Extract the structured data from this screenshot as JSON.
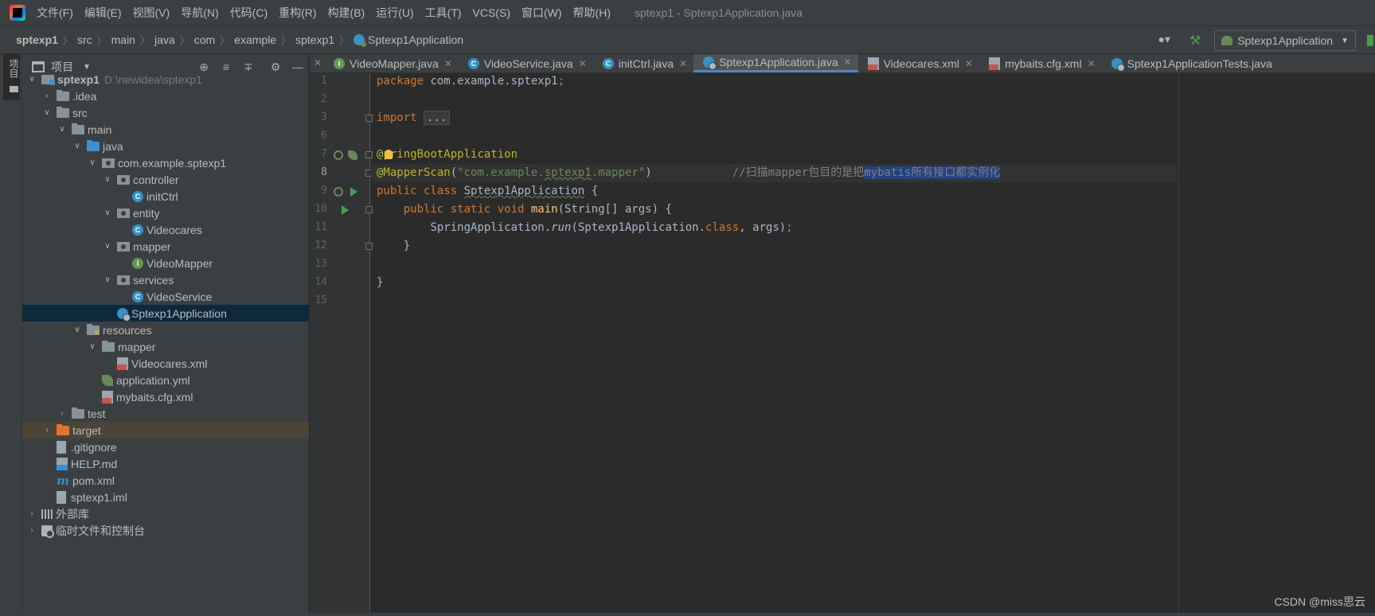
{
  "menubar": {
    "items": [
      "文件(F)",
      "编辑(E)",
      "视图(V)",
      "导航(N)",
      "代码(C)",
      "重构(R)",
      "构建(B)",
      "运行(U)",
      "工具(T)",
      "VCS(S)",
      "窗口(W)",
      "帮助(H)"
    ],
    "window_title": "sptexp1 - Sptexp1Application.java"
  },
  "navbar": {
    "breadcrumb": [
      "sptexp1",
      "src",
      "main",
      "java",
      "com",
      "example",
      "sptexp1",
      "Sptexp1Application"
    ],
    "run_config": "Sptexp1Application"
  },
  "left_stripe": {
    "project_label": "项目"
  },
  "project_panel": {
    "title": "项目",
    "tree": [
      {
        "label": "sptexp1",
        "path": "D:\\newidea\\sptexp1",
        "icon": "module-folder"
      },
      {
        "label": ".idea",
        "icon": "folder"
      },
      {
        "label": "src",
        "icon": "folder"
      },
      {
        "label": "main",
        "icon": "folder"
      },
      {
        "label": "java",
        "icon": "source-folder"
      },
      {
        "label": "com.example.sptexp1",
        "icon": "package"
      },
      {
        "label": "controller",
        "icon": "package"
      },
      {
        "label": "initCtrl",
        "icon": "class"
      },
      {
        "label": "entity",
        "icon": "package"
      },
      {
        "label": "Videocares",
        "icon": "class"
      },
      {
        "label": "mapper",
        "icon": "package"
      },
      {
        "label": "VideoMapper",
        "icon": "interface"
      },
      {
        "label": "services",
        "icon": "package"
      },
      {
        "label": "VideoService",
        "icon": "class"
      },
      {
        "label": "Sptexp1Application",
        "icon": "spring-boot-class"
      },
      {
        "label": "resources",
        "icon": "resources-folder"
      },
      {
        "label": "mapper",
        "icon": "folder"
      },
      {
        "label": "Videocares.xml",
        "icon": "xml-file"
      },
      {
        "label": "application.yml",
        "icon": "yaml-file"
      },
      {
        "label": "mybaits.cfg.xml",
        "icon": "xml-file"
      },
      {
        "label": "test",
        "icon": "folder"
      },
      {
        "label": "target",
        "icon": "excluded-folder"
      },
      {
        "label": ".gitignore",
        "icon": "file"
      },
      {
        "label": "HELP.md",
        "icon": "markdown-file"
      },
      {
        "label": "pom.xml",
        "icon": "maven-file"
      },
      {
        "label": "sptexp1.iml",
        "icon": "file"
      },
      {
        "label": "外部库",
        "icon": "library"
      },
      {
        "label": "临时文件和控制台",
        "icon": "scratch"
      }
    ]
  },
  "editor": {
    "tabs": [
      {
        "label": "VideoMapper.java",
        "icon": "interface",
        "active": false
      },
      {
        "label": "VideoService.java",
        "icon": "class",
        "active": false
      },
      {
        "label": "initCtrl.java",
        "icon": "class",
        "active": false
      },
      {
        "label": "Sptexp1Application.java",
        "icon": "spring-boot-class",
        "active": true
      },
      {
        "label": "Videocares.xml",
        "icon": "xml-file",
        "active": false
      },
      {
        "label": "mybaits.cfg.xml",
        "icon": "xml-file",
        "active": false
      },
      {
        "label": "Sptexp1ApplicationTests.java",
        "icon": "spring-boot-class",
        "active": false
      }
    ],
    "line_numbers": [
      "1",
      "2",
      "3",
      "6",
      "7",
      "8",
      "9",
      "10",
      "11",
      "12",
      "13",
      "14",
      "15"
    ],
    "current_line": "8",
    "code": {
      "l1_kw": "package",
      "l1_rest": " com.example.sptexp1",
      "l1_semi": ";",
      "l3_kw": "import",
      "l3_fold": "...",
      "l7_at": "@",
      "l7_ann": "pringBootApplication",
      "l8_ann": "@MapperScan",
      "l8_p1": "(",
      "l8_s1": "\"com.example.",
      "l8_s2": "sptexp1",
      "l8_s3": ".mapper\"",
      "l8_p2": ")",
      "l8_cmt": "//扫描mapper包目的是把",
      "l8_cmt_sel": "mybatis所有接口都实例化",
      "l9_kw": "public class ",
      "l9_cls": "Sptexp1Application",
      "l9_rest": " {",
      "l10_indent": "    ",
      "l10_kw": "public static void ",
      "l10_mth": "main",
      "l10_rest": "(String[] args) {",
      "l11_indent": "        ",
      "l11_a": "SpringApplication.",
      "l11_run": "run",
      "l11_b": "(Sptexp1Application.",
      "l11_cls": "class",
      "l11_c": ", args)",
      "l11_semi": ";",
      "l12": "    }",
      "l14": "}"
    }
  },
  "watermark": "CSDN @miss思云",
  "colors": {
    "background": "#2b2b2b",
    "panel": "#3c3f41",
    "selection": "#0d293e",
    "keyword": "#cc7832",
    "annotation": "#bbb529",
    "string": "#6a8759",
    "comment": "#808080",
    "method": "#ffc66d",
    "active_tab_underline": "#4a88c7"
  }
}
